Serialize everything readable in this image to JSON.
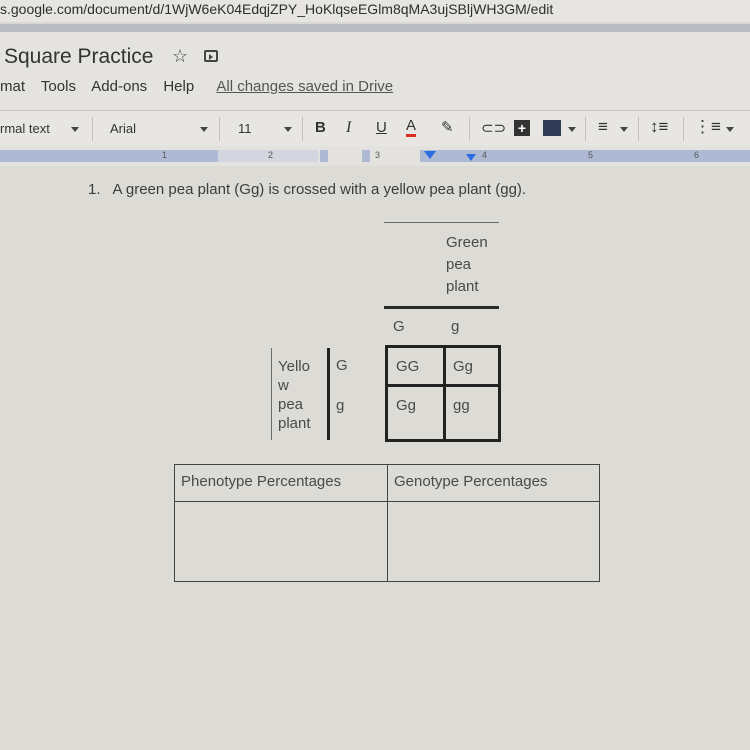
{
  "browser": {
    "url": "s.google.com/document/d/1WjW6eK04EdqjZPY_HoKlqseEGlm8qMA3ujSBljWH3GM/edit"
  },
  "doc": {
    "title": "Square Practice",
    "icons": [
      "star-icon",
      "move-to-folder-icon"
    ],
    "save_status": "All changes saved in Drive"
  },
  "menu": {
    "items": [
      "mat",
      "Tools",
      "Add-ons",
      "Help"
    ]
  },
  "toolbar": {
    "style": "rmal text",
    "font": "Arial",
    "size": "11",
    "bold": "B",
    "italic": "I",
    "underline": "U",
    "text_color": "A",
    "text_color_hex": "#d93025",
    "icons": [
      "highlighter-icon",
      "link-icon",
      "add-comment-icon",
      "insert-image-icon",
      "align-icon",
      "line-spacing-icon",
      "numbered-list-icon"
    ]
  },
  "ruler": {
    "labels": [
      "1",
      "2",
      "3",
      "4",
      "5",
      "6"
    ]
  },
  "content": {
    "question_number": "1.",
    "question_text": "A green pea plant (Gg) is crossed with a yellow pea plant (gg).",
    "punnett": {
      "top_parent_label": [
        "Green",
        "pea",
        "plant"
      ],
      "top_alleles": [
        "G",
        "g"
      ],
      "side_parent_label": [
        "Yello",
        "w",
        "pea",
        "plant"
      ],
      "side_alleles": [
        "G",
        "g"
      ],
      "cells": [
        [
          "GG",
          "Gg"
        ],
        [
          "Gg",
          "gg"
        ]
      ]
    },
    "percent_table": {
      "headers": [
        "Phenotype Percentages",
        "Genotype Percentages"
      ],
      "rows": [
        [
          "",
          ""
        ]
      ]
    }
  }
}
